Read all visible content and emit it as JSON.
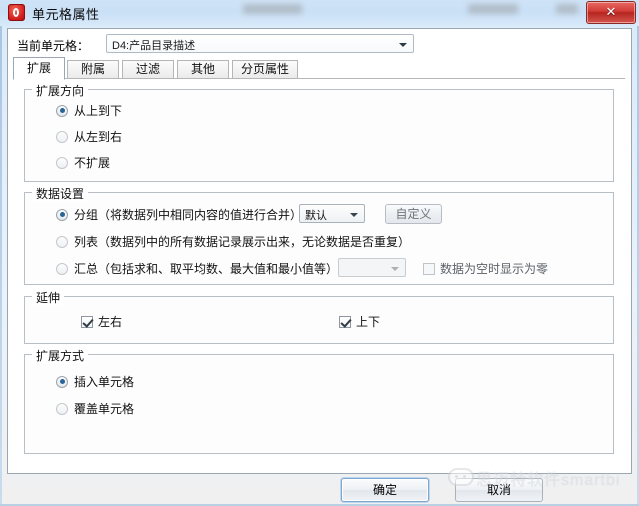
{
  "window": {
    "title": "单元格属性",
    "icon": "app-icon",
    "close_label": "✕"
  },
  "cell_selector": {
    "label": "当前单元格：",
    "value": "D4:产品目录描述"
  },
  "tabs": [
    {
      "label": "扩展",
      "active": true
    },
    {
      "label": "附属",
      "active": false
    },
    {
      "label": "过滤",
      "active": false
    },
    {
      "label": "其他",
      "active": false
    },
    {
      "label": "分页属性",
      "active": false
    }
  ],
  "groups": {
    "direction": {
      "title": "扩展方向",
      "options": [
        {
          "label": "从上到下",
          "checked": true
        },
        {
          "label": "从左到右",
          "checked": false
        },
        {
          "label": "不扩展",
          "checked": false
        }
      ]
    },
    "data_settings": {
      "title": "数据设置",
      "options": [
        {
          "label": "分组（将数据列中相同内容的值进行合并）",
          "checked": true
        },
        {
          "label": "列表（数据列中的所有数据记录展示出来，无论数据是否重复）",
          "checked": false
        },
        {
          "label": "汇总（包括求和、取平均数、最大值和最小值等）",
          "checked": false
        }
      ],
      "group_combo": {
        "value": "默认",
        "enabled": true
      },
      "custom_button": {
        "label": "自定义",
        "enabled": false
      },
      "summary_combo": {
        "value": "",
        "enabled": false
      },
      "zero_checkbox": {
        "label": "数据为空时显示为零",
        "checked": false,
        "enabled": false
      }
    },
    "extend": {
      "title": "延伸",
      "checkboxes": [
        {
          "label": "左右",
          "checked": true
        },
        {
          "label": "上下",
          "checked": true
        }
      ]
    },
    "expand_mode": {
      "title": "扩展方式",
      "options": [
        {
          "label": "插入单元格",
          "checked": true
        },
        {
          "label": "覆盖单元格",
          "checked": false
        }
      ]
    }
  },
  "footer": {
    "ok_label": "确定",
    "cancel_label": "取消"
  },
  "watermark": {
    "text": "思迈特软件smartbi"
  },
  "colors": {
    "titlebar": "#c9e0f6",
    "accent": "#2a6496",
    "close_red": "#d03a35",
    "client_bg": "#ffffff"
  }
}
